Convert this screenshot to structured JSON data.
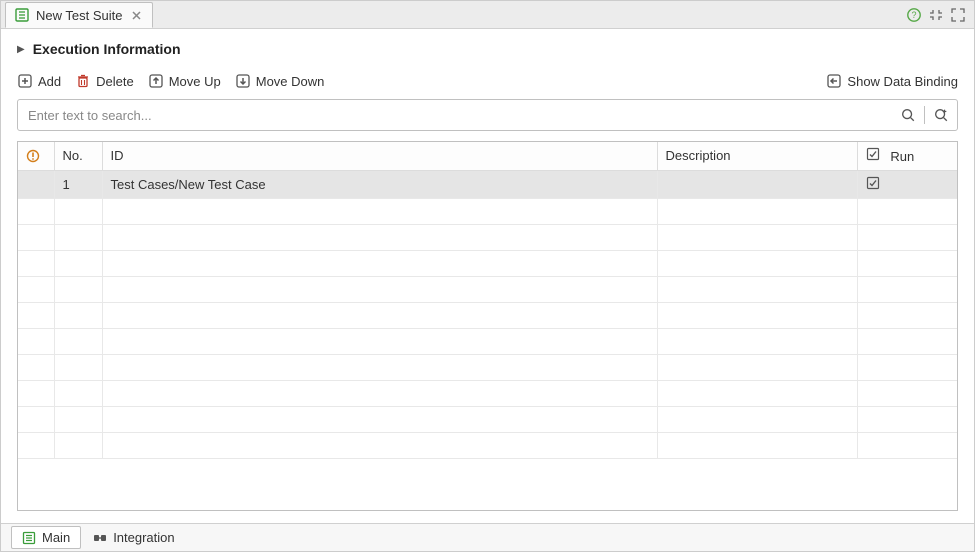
{
  "tab": {
    "title": "New Test Suite"
  },
  "section": {
    "title": "Execution Information"
  },
  "toolbar": {
    "add": "Add",
    "delete": "Delete",
    "moveUp": "Move Up",
    "moveDown": "Move Down",
    "showDataBinding": "Show Data Binding"
  },
  "search": {
    "placeholder": "Enter text to search..."
  },
  "table": {
    "headers": {
      "no": "No.",
      "id": "ID",
      "description": "Description",
      "run": "Run"
    },
    "rows": [
      {
        "no": "1",
        "id": "Test Cases/New Test Case",
        "description": "",
        "run": true
      }
    ]
  },
  "bottomTabs": {
    "main": "Main",
    "integration": "Integration"
  }
}
